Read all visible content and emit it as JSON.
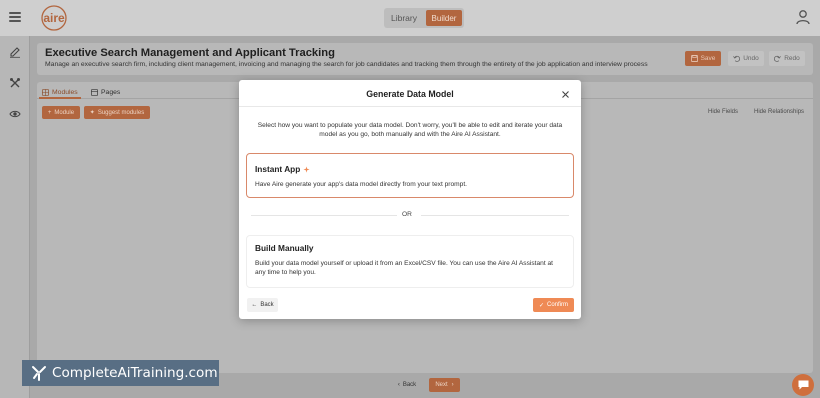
{
  "topbar": {
    "logo_text": "aire",
    "nav": {
      "library_label": "Library",
      "builder_label": "Builder"
    }
  },
  "sidebar": {
    "icons": [
      "edit-icon",
      "tools-icon",
      "eye-icon"
    ]
  },
  "header": {
    "title": "Executive Search Management and Applicant Tracking",
    "description": "Manage an executive search firm, including client management, invoicing and managing the search for job candidates and tracking them through the entirety of the job application and interview process",
    "save_label": "Save",
    "undo_label": "Undo",
    "redo_label": "Redo"
  },
  "tabs": [
    {
      "label": "Modules",
      "active": true
    },
    {
      "label": "Pages",
      "active": false
    }
  ],
  "toolbar": {
    "module_label": "Module",
    "suggest_label": "Suggest modules",
    "hide_fields_label": "Hide Fields",
    "hide_relationships_label": "Hide Relationships"
  },
  "footer": {
    "back_label": "Back",
    "next_label": "Next"
  },
  "modal": {
    "title": "Generate Data Model",
    "intro": "Select how you want to populate your data model. Don't worry, you'll be able to edit and iterate your data model as you go, both manually and with the Aire AI Assistant.",
    "instant_app": {
      "title": "Instant App",
      "text": "Have Aire generate your app's data model directly from your text prompt."
    },
    "or_label": "OR",
    "build_manually": {
      "title": "Build Manually",
      "text": "Build your data model yourself or upload it from an Excel/CSV file. You can use the Aire AI Assistant at any time to help you."
    },
    "back_label": "Back",
    "confirm_label": "Confirm"
  },
  "watermark": {
    "text": "CompleteAiTraining.com"
  },
  "colors": {
    "accent": "#ef8a55",
    "accent_dim": "#b2663f",
    "overlay": "#a9a9a9",
    "watermark_bg": "#586e84"
  }
}
